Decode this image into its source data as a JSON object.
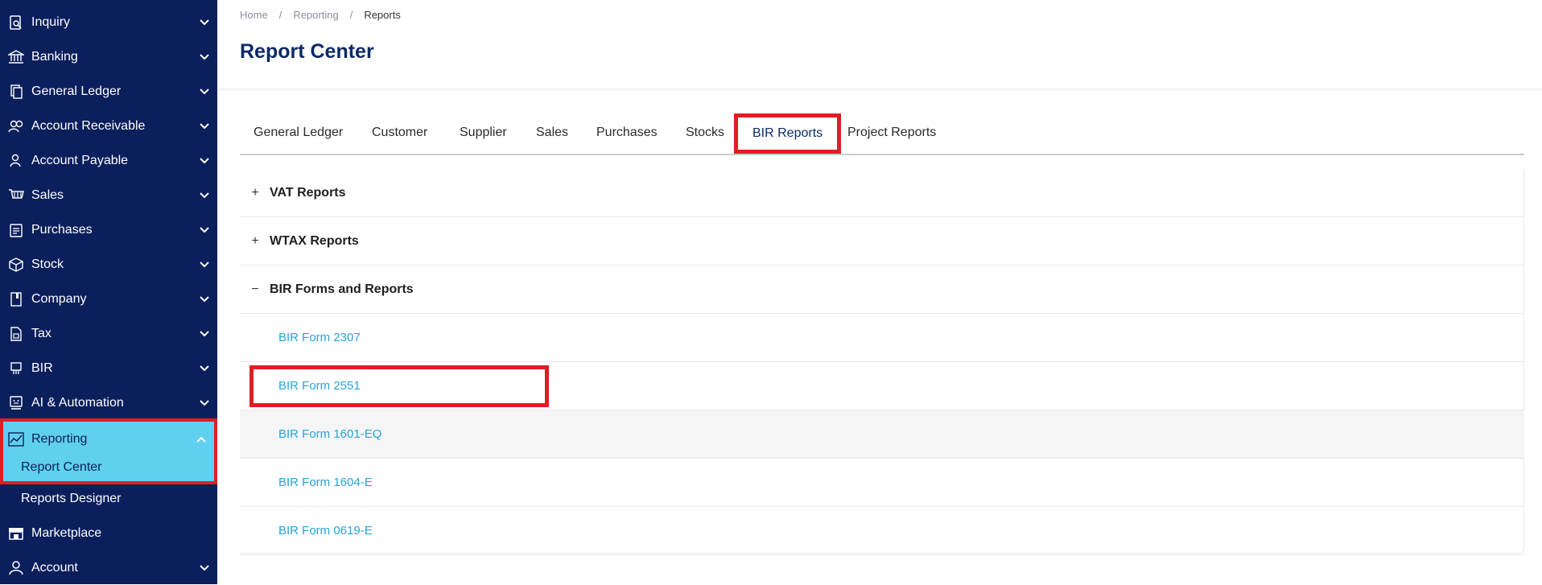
{
  "sidebar": {
    "items": [
      {
        "label": "Inquiry",
        "icon": "inquiry-icon"
      },
      {
        "label": "Banking",
        "icon": "bank-icon"
      },
      {
        "label": "General Ledger",
        "icon": "ledger-icon"
      },
      {
        "label": "Account Receivable",
        "icon": "receivable-icon"
      },
      {
        "label": "Account Payable",
        "icon": "payable-icon"
      },
      {
        "label": "Sales",
        "icon": "cart-icon"
      },
      {
        "label": "Purchases",
        "icon": "clipboard-icon"
      },
      {
        "label": "Stock",
        "icon": "cube-icon"
      },
      {
        "label": "Company",
        "icon": "bookmark-icon"
      },
      {
        "label": "Tax",
        "icon": "tax-icon"
      },
      {
        "label": "BIR",
        "icon": "bir-icon"
      },
      {
        "label": "AI & Automation",
        "icon": "robot-icon"
      }
    ],
    "reporting": {
      "label": "Reporting",
      "icon": "chart-line-icon",
      "sub_item": "Report Center"
    },
    "reports_designer": "Reports Designer",
    "marketplace": {
      "label": "Marketplace",
      "icon": "store-icon"
    },
    "account": {
      "label": "Account",
      "icon": "user-icon"
    }
  },
  "breadcrumb": {
    "home": "Home",
    "reporting": "Reporting",
    "current": "Reports",
    "separator": "/"
  },
  "page_title": "Report Center",
  "tabs": [
    "General Ledger",
    "Customer",
    "Supplier",
    "Sales",
    "Purchases",
    "Stocks",
    "BIR Reports",
    "Project Reports"
  ],
  "active_tab": "BIR Reports",
  "groups": [
    {
      "label": "VAT Reports",
      "toggle": "+"
    },
    {
      "label": "WTAX Reports",
      "toggle": "+"
    },
    {
      "label": "BIR Forms and Reports",
      "toggle": "−"
    }
  ],
  "forms": [
    "BIR Form 2307",
    "BIR Form 2551",
    "BIR Form 1601-EQ",
    "BIR Form 1604-E",
    "BIR Form 0619-E"
  ],
  "colors": {
    "sidebar": "#0b1f5c",
    "highlight": "#5fd0ef",
    "annotation": "#e11d24",
    "link": "#29a3d6",
    "title": "#0b2a66"
  }
}
